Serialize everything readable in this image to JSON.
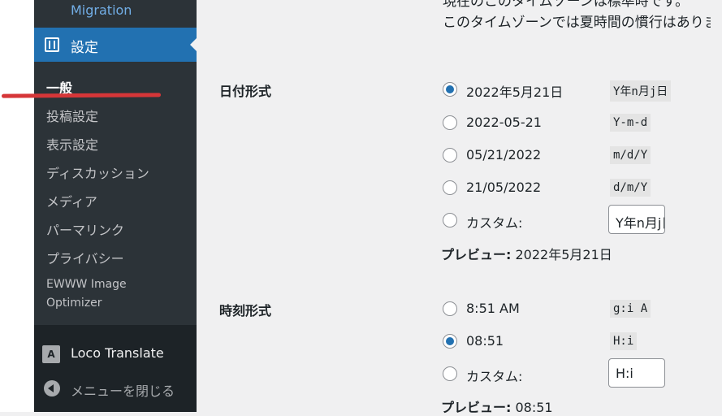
{
  "sidebar": {
    "migration_label": "Migration",
    "settings_label": "設定",
    "submenu": [
      {
        "label": "一般"
      },
      {
        "label": "投稿設定"
      },
      {
        "label": "表示設定"
      },
      {
        "label": "ディスカッション"
      },
      {
        "label": "メディア"
      },
      {
        "label": "パーマリンク"
      },
      {
        "label": "プライバシー"
      },
      {
        "label": "EWWW Image"
      },
      {
        "label": "Optimizer"
      }
    ],
    "loco_label": "Loco Translate",
    "collapse_label": "メニューを閉じる"
  },
  "timezone": {
    "line1": "現在のこのタイムゾーンは標準時です。",
    "line2": "このタイムゾーンでは夏時間の慣行はありま"
  },
  "date_format": {
    "label": "日付形式",
    "options": [
      {
        "label": "2022年5月21日",
        "code": "Y年n月j日",
        "checked": true
      },
      {
        "label": "2022-05-21",
        "code": "Y-m-d",
        "checked": false
      },
      {
        "label": "05/21/2022",
        "code": "m/d/Y",
        "checked": false
      },
      {
        "label": "21/05/2022",
        "code": "d/m/Y",
        "checked": false
      }
    ],
    "custom_label": "カスタム:",
    "custom_value": "Y年n月j日",
    "preview_label": "プレビュー:",
    "preview_value": "2022年5月21日"
  },
  "time_format": {
    "label": "時刻形式",
    "options": [
      {
        "label": "8:51 AM",
        "code": "g:i A",
        "checked": false
      },
      {
        "label": "08:51",
        "code": "H:i",
        "checked": true
      }
    ],
    "custom_label": "カスタム:",
    "custom_value": "H:i",
    "preview_label": "プレビュー:",
    "preview_value": "08:51"
  },
  "colors": {
    "sidebar_bg": "#1d2327",
    "submenu_bg": "#2c3338",
    "accent": "#2271b1",
    "annotation_red": "#d63638"
  }
}
